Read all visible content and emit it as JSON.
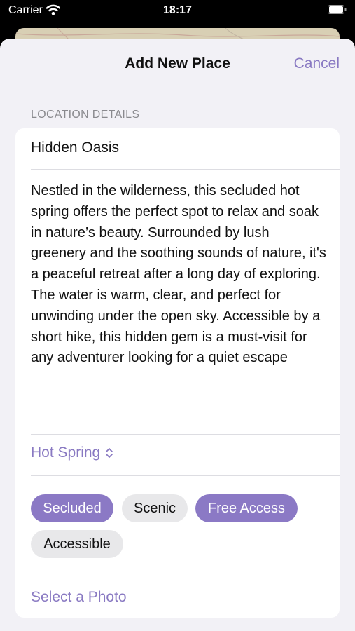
{
  "status_bar": {
    "carrier": "Carrier",
    "time": "18:17"
  },
  "nav": {
    "title": "Add New Place",
    "cancel_label": "Cancel"
  },
  "form": {
    "section_header": "LOCATION DETAILS",
    "name_value": "Hidden Oasis",
    "description_value": "Nestled in the wilderness, this secluded hot spring offers the perfect spot to relax and soak in nature’s beauty. Surrounded by lush greenery and the soothing sounds of nature, it's a peaceful retreat after a long day of exploring. The water is warm, clear, and perfect for unwinding under the open sky. Accessible by a short hike, this hidden gem is a must-visit for any adventurer looking for a quiet escape",
    "category_value": "Hot Spring",
    "tags": [
      {
        "label": "Secluded",
        "selected": true
      },
      {
        "label": "Scenic",
        "selected": false
      },
      {
        "label": "Free Access",
        "selected": true
      },
      {
        "label": "Accessible",
        "selected": false
      }
    ],
    "photo_label": "Select a Photo"
  },
  "colors": {
    "accent": "#8979c2",
    "chip_selected": "#8b79c5",
    "chip_unselected": "#e8e8ea",
    "sheet_background": "#f2f1f6"
  },
  "icons": {
    "status": [
      "wifi-icon",
      "battery-icon"
    ],
    "category_picker": "chevron-updown-icon"
  }
}
